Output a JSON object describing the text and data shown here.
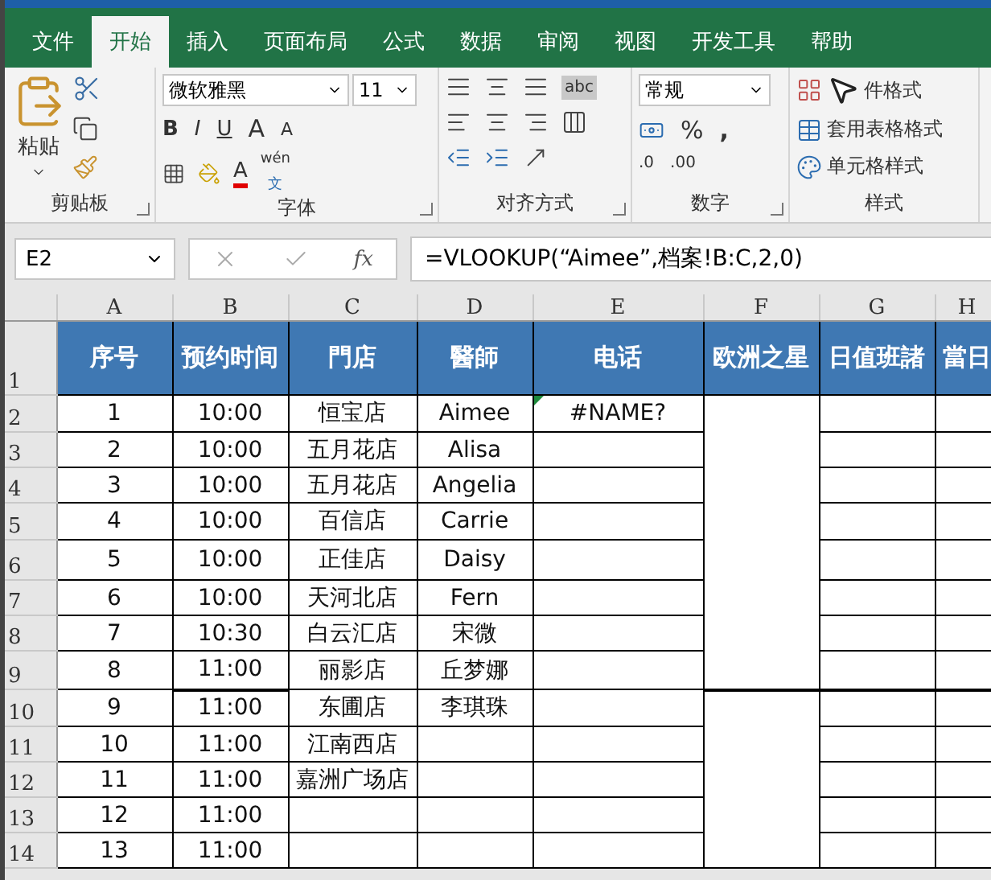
{
  "ribbon": {
    "tabs": [
      {
        "label": "文件",
        "selected": false
      },
      {
        "label": "开始",
        "selected": true
      },
      {
        "label": "插入",
        "selected": false
      },
      {
        "label": "页面布局",
        "selected": false
      },
      {
        "label": "公式",
        "selected": false
      },
      {
        "label": "数据",
        "selected": false
      },
      {
        "label": "审阅",
        "selected": false
      },
      {
        "label": "视图",
        "selected": false
      },
      {
        "label": "开发工具",
        "selected": false
      },
      {
        "label": "帮助",
        "selected": false
      }
    ],
    "clipboard": {
      "paste": "粘贴",
      "label": "剪贴板"
    },
    "font": {
      "name": "微软雅黑",
      "size": "11",
      "bold": "B",
      "italic": "I",
      "underline": "U",
      "grow": "A",
      "shrink": "A",
      "font_color": "A",
      "phonetic": "wén",
      "phonetic_char": "文",
      "label": "字体"
    },
    "alignment": {
      "wrap": "abc",
      "label": "对齐方式"
    },
    "number": {
      "format": "常规",
      "percent": "%",
      "comma": ",",
      "increase_decimal": ".00",
      "decrease_decimal": ".0",
      "label": "数字"
    },
    "styles": {
      "items": [
        "件格式",
        "套用表格格式",
        "单元格样式"
      ],
      "label": "样式"
    }
  },
  "formula_bar": {
    "name_box": "E2",
    "fx": "fx",
    "formula": "=VLOOKUP(“Aimee”,档案!B:C,2,0)"
  },
  "sheet": {
    "columns": [
      "A",
      "B",
      "C",
      "D",
      "E",
      "F",
      "G",
      "H"
    ],
    "header": {
      "row": "1",
      "cells": [
        "序号",
        "预约时间",
        "門店",
        "醫師",
        "电话",
        "欧洲之星",
        "日值班諸",
        "當日"
      ]
    },
    "rows": [
      {
        "row": "2",
        "a": "1",
        "b": "10:00",
        "c": "恒宝店",
        "d": "Aimee",
        "e": "#NAME?",
        "error_flag": true
      },
      {
        "row": "3",
        "a": "2",
        "b": "10:00",
        "c": "五月花店",
        "d": "Alisa"
      },
      {
        "row": "4",
        "a": "3",
        "b": "10:00",
        "c": "五月花店",
        "d": "Angelia"
      },
      {
        "row": "5",
        "a": "4",
        "b": "10:00",
        "c": "百信店",
        "d": "Carrie"
      },
      {
        "row": "6",
        "a": "5",
        "b": "10:00",
        "c": "正佳店",
        "d": "Daisy"
      },
      {
        "row": "7",
        "a": "6",
        "b": "10:00",
        "c": "天河北店",
        "d": "Fern"
      },
      {
        "row": "8",
        "a": "7",
        "b": "10:30",
        "c": "白云汇店",
        "d": "宋微"
      },
      {
        "row": "9",
        "a": "8",
        "b": "11:00",
        "c": "丽影店",
        "d": "丘梦娜"
      },
      {
        "row": "10",
        "a": "9",
        "b": "11:00",
        "c": "东圃店",
        "d": "李琪珠"
      },
      {
        "row": "11",
        "a": "10",
        "b": "11:00",
        "c": "江南西店"
      },
      {
        "row": "12",
        "a": "11",
        "b": "11:00",
        "c": "嘉洲广场店"
      },
      {
        "row": "13",
        "a": "12",
        "b": "11:00"
      },
      {
        "row": "14",
        "a": "13",
        "b": "11:00"
      }
    ]
  }
}
